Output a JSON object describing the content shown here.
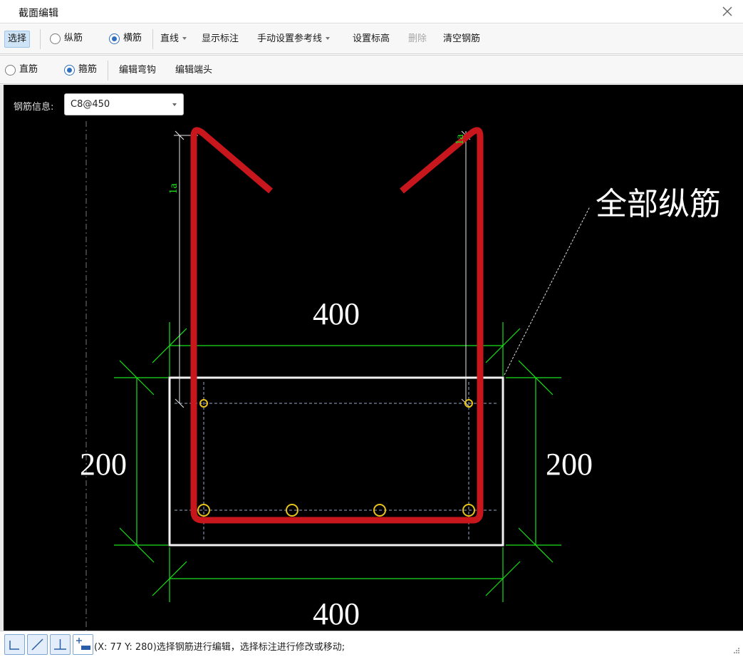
{
  "window": {
    "title": "截面编辑"
  },
  "toolbar1": {
    "select": "选择",
    "longitudinal": "纵筋",
    "transverse": "横筋",
    "line": "直线",
    "show_dims": "显示标注",
    "manual_ref": "手动设置参考线",
    "set_elevation": "设置标高",
    "delete": "删除",
    "clear": "清空钢筋"
  },
  "toolbar2": {
    "straight": "直筋",
    "stirrup": "箍筋",
    "edit_hook": "编辑弯钩",
    "edit_end": "编辑端头"
  },
  "rebar_info": {
    "label": "钢筋信息:",
    "value": "C8@450"
  },
  "drawing": {
    "width_top": "400",
    "width_bottom": "400",
    "height_left": "200",
    "height_right": "200",
    "anchor_left": "1a",
    "anchor_right": "1a",
    "callout": "全部纵筋"
  },
  "status": {
    "text": "(X: 77 Y: 280)选择钢筋进行编辑，选择标注进行修改或移动;"
  },
  "icons": {
    "close": "close-icon",
    "orthogonal": "orthogonal-icon",
    "diagonal": "diagonal-line-icon",
    "perpendicular": "perpendicular-icon",
    "add_point": "add-point-icon"
  },
  "colors": {
    "rebar": "#c8161d",
    "dimension": "#19e019",
    "section": "#ffffff",
    "longitudinal_bar": "#e6c31a"
  }
}
